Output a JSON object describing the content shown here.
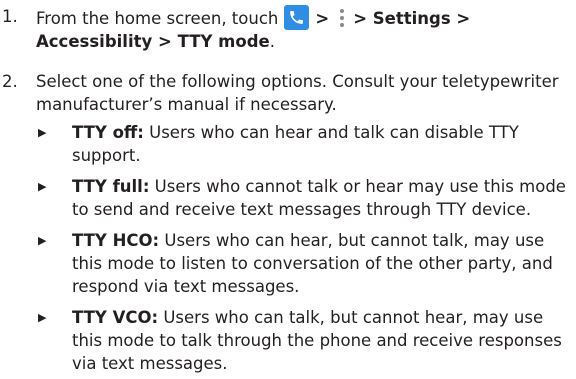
{
  "steps": [
    {
      "number": "1.",
      "from_text": "From the home screen, touch",
      "sep1": ">",
      "sep2": "> ",
      "settings": "Settings",
      "sep3": " >",
      "accessibility": "Accessibility",
      "sep4": " > ",
      "tty_mode": "TTY mode",
      "end": "."
    },
    {
      "number": "2.",
      "text": "Select one of the following options. Consult your teletypewriter manufacturer’s manual if necessary."
    }
  ],
  "options": [
    {
      "term": "TTY off:",
      "desc": " Users who can hear and talk can disable TTY support."
    },
    {
      "term": "TTY full:",
      "desc": " Users who cannot talk or hear may use this mode to send and receive text messages through TTY device."
    },
    {
      "term": "TTY HCO:",
      "desc": " Users who can hear, but cannot talk, may use this mode to listen to conversation of the other party, and respond via text messages."
    },
    {
      "term": "TTY VCO:",
      "desc": " Users who can talk, but cannot hear, may use this mode to talk through the phone and receive responses via text messages."
    }
  ],
  "icons": {
    "phone": "phone-icon",
    "menu": "more-vert-icon",
    "bullet": "triangle-bullet-icon",
    "phone_color": "#2f8ee4",
    "menu_color": "#8a8a8a"
  }
}
